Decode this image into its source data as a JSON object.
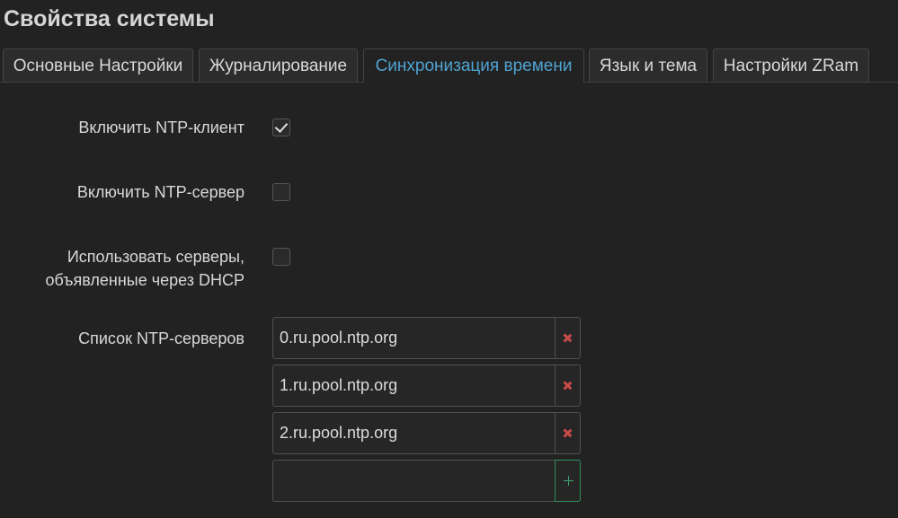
{
  "page": {
    "title": "Свойства системы"
  },
  "tabs": [
    {
      "label": "Основные Настройки",
      "active": false
    },
    {
      "label": "Журналирование",
      "active": false
    },
    {
      "label": "Синхронизация времени",
      "active": true
    },
    {
      "label": "Язык и тема",
      "active": false
    },
    {
      "label": "Настройки ZRam",
      "active": false
    }
  ],
  "form": {
    "enable_ntp_client": {
      "label": "Включить NTP-клиент",
      "checked": true
    },
    "enable_ntp_server": {
      "label": "Включить NTP-сервер",
      "checked": false
    },
    "use_dhcp_servers": {
      "label_line1": "Использовать серверы,",
      "label_line2": "объявленные через DHCP",
      "checked": false
    },
    "ntp_servers": {
      "label": "Список NTP-серверов",
      "items": [
        "0.ru.pool.ntp.org",
        "1.ru.pool.ntp.org",
        "2.ru.pool.ntp.org"
      ],
      "new_value": ""
    }
  },
  "colors": {
    "background": "#222222",
    "active_tab": "#4fa3d1",
    "remove": "#c94a4a",
    "add": "#3aa36e"
  },
  "icons": {
    "check": "check-icon",
    "remove": "remove-icon",
    "add": "plus-icon"
  }
}
